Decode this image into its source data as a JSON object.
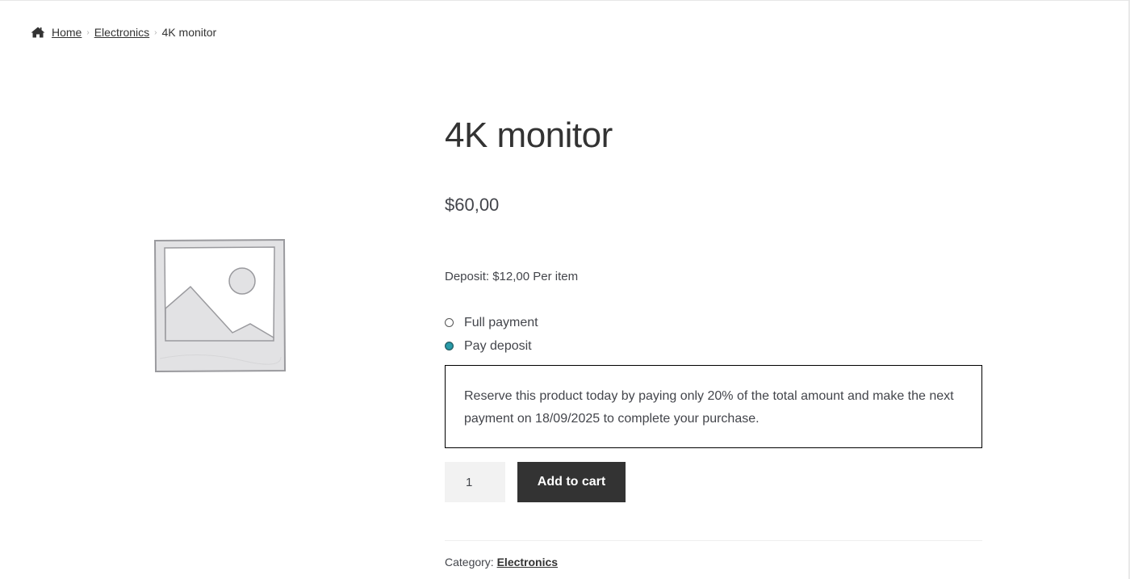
{
  "breadcrumb": {
    "icon": "home-icon",
    "items": [
      {
        "label": "Home"
      },
      {
        "label": "Electronics"
      },
      {
        "label": "4K monitor"
      }
    ]
  },
  "product": {
    "image_icon": "image-placeholder-icon",
    "title": "4K monitor",
    "price": "$60,00",
    "deposit_note": "Deposit: $12,00 Per item",
    "payment_options": [
      {
        "label": "Full payment",
        "selected": false
      },
      {
        "label": "Pay deposit",
        "selected": true
      }
    ],
    "deposit_message": "Reserve this product today by paying only 20% of the total amount and make the next payment on 18/09/2025 to complete your purchase.",
    "quantity": "1",
    "add_to_cart_label": "Add to cart",
    "category_label": "Category:",
    "category_value": "Electronics"
  },
  "colors": {
    "button_bg": "#333333",
    "radio_selected": "#1f8796",
    "text": "#43454b"
  }
}
